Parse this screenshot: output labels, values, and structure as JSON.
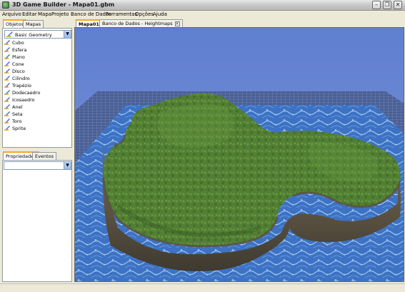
{
  "window": {
    "title": "3D Game Builder - Mapa01.gbm"
  },
  "menu": [
    "Arquivo",
    "Editar",
    "Mapa",
    "Projeto",
    "Banco de Dados",
    "Ferramentas",
    "Opções",
    "Ajuda"
  ],
  "left_panel": {
    "tabs": [
      "Objetos",
      "Mapas"
    ],
    "combo_value": "Basic Geometry",
    "objects": [
      "Cubo",
      "Esfera",
      "Plano",
      "Cone",
      "Disco",
      "Cilindro",
      "Trapézio",
      "Dodecaedro",
      "Icosaedro",
      "Anel",
      "Seta",
      "Toro",
      "Sprite"
    ],
    "bottom_tabs": [
      "Propriedades",
      "Eventos"
    ]
  },
  "doc_tabs": [
    "Mapa01",
    "Banco de Dados - Heightmaps"
  ],
  "colors": {
    "sky": "#6a85d0",
    "water": "#3a6fc0",
    "grass": "#4f8a32",
    "rock": "#6e6450"
  }
}
